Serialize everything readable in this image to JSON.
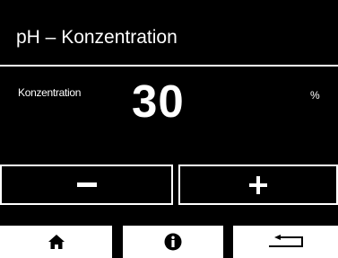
{
  "header": {
    "title": "pH – Konzentration"
  },
  "value_panel": {
    "label": "Konzentration",
    "value": "30",
    "unit": "%"
  },
  "controls": {
    "decrement_icon": "minus-icon",
    "increment_icon": "plus-icon"
  },
  "nav": {
    "home_icon": "home-icon",
    "info_icon": "info-icon",
    "back_icon": "back-arrow-icon"
  },
  "colors": {
    "background": "#000000",
    "foreground": "#ffffff"
  }
}
